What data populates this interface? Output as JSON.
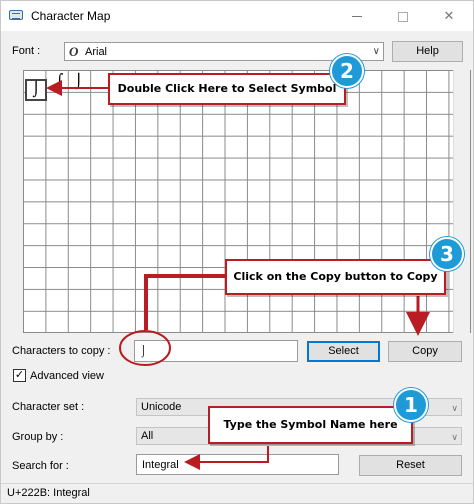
{
  "window": {
    "title": "Character Map",
    "controls": {
      "minimize": "minimize",
      "maximize": "maximize",
      "close": "✕"
    }
  },
  "font_row": {
    "label": "Font :",
    "font_icon": "O",
    "value": "Arial",
    "help_button": "Help"
  },
  "grid": {
    "symbols": [
      "⌡",
      "⌠",
      "⌡"
    ]
  },
  "copy_row": {
    "label": "Characters to copy :",
    "value": "⌡",
    "select_button": "Select",
    "copy_button": "Copy"
  },
  "advanced": {
    "label": "Advanced view",
    "checked": "✓"
  },
  "character_set": {
    "label": "Character set :",
    "value": "Unicode"
  },
  "group_by": {
    "label": "Group by :",
    "value": "All"
  },
  "search": {
    "label": "Search for :",
    "value": "Integral",
    "reset_button": "Reset"
  },
  "status": "U+222B: Integral",
  "annotations": {
    "step1": {
      "number": "1",
      "text": "Type the Symbol Name here"
    },
    "step2": {
      "number": "2",
      "text": "Double Click Here to Select Symbol"
    },
    "step3": {
      "number": "3",
      "text": "Click on the Copy button to Copy"
    },
    "color": "#b91c22",
    "badge_color": "#1e9ad6"
  }
}
